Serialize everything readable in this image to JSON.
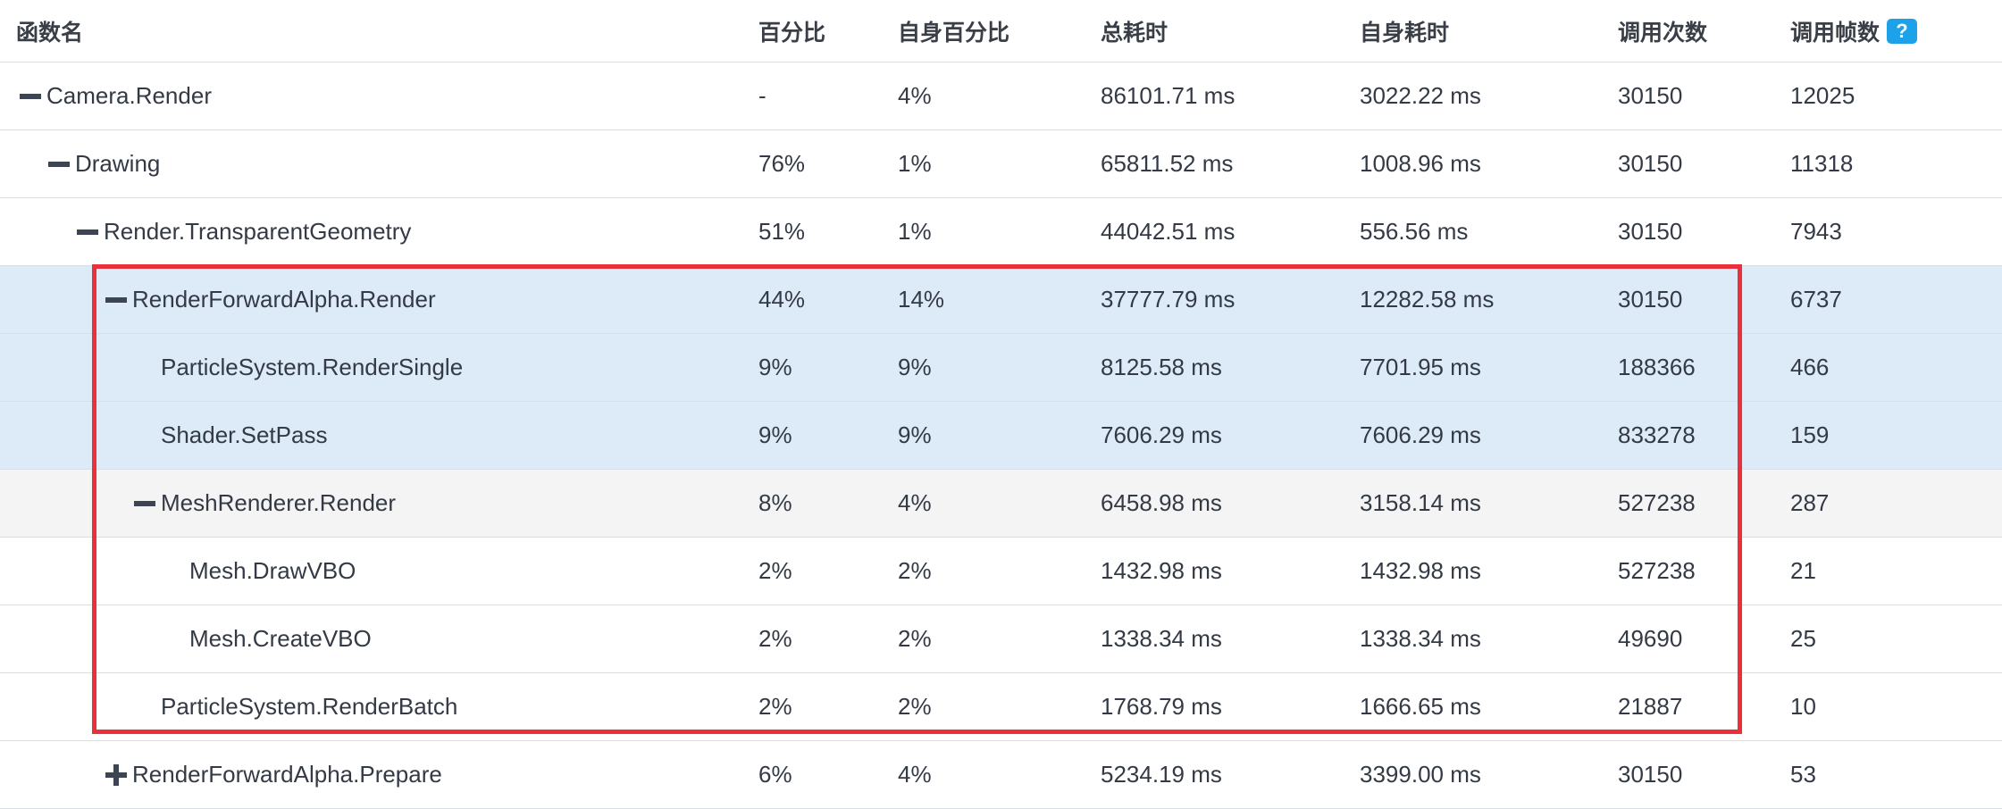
{
  "header": {
    "function_name": "函数名",
    "percent": "百分比",
    "self_percent": "自身百分比",
    "total_time": "总耗时",
    "self_time": "自身耗时",
    "call_count": "调用次数",
    "call_frames": "调用帧数",
    "help_icon": "?"
  },
  "rows": [
    {
      "name": "Camera.Render",
      "percent": "-",
      "self_percent": "4%",
      "total_time": "86101.71 ms",
      "self_time": "3022.22 ms",
      "calls": "30150",
      "frames": "12025",
      "toggle": "minus",
      "depth": 0
    },
    {
      "name": "Drawing",
      "percent": "76%",
      "self_percent": "1%",
      "total_time": "65811.52 ms",
      "self_time": "1008.96 ms",
      "calls": "30150",
      "frames": "11318",
      "toggle": "minus",
      "depth": 1
    },
    {
      "name": "Render.TransparentGeometry",
      "percent": "51%",
      "self_percent": "1%",
      "total_time": "44042.51 ms",
      "self_time": "556.56 ms",
      "calls": "30150",
      "frames": "7943",
      "toggle": "minus",
      "depth": 2
    },
    {
      "name": "RenderForwardAlpha.Render",
      "percent": "44%",
      "self_percent": "14%",
      "total_time": "37777.79 ms",
      "self_time": "12282.58 ms",
      "calls": "30150",
      "frames": "6737",
      "toggle": "minus",
      "depth": 3
    },
    {
      "name": "ParticleSystem.RenderSingle",
      "percent": "9%",
      "self_percent": "9%",
      "total_time": "8125.58 ms",
      "self_time": "7701.95 ms",
      "calls": "188366",
      "frames": "466",
      "toggle": "none",
      "depth": 4
    },
    {
      "name": "Shader.SetPass",
      "percent": "9%",
      "self_percent": "9%",
      "total_time": "7606.29 ms",
      "self_time": "7606.29 ms",
      "calls": "833278",
      "frames": "159",
      "toggle": "none",
      "depth": 4
    },
    {
      "name": "MeshRenderer.Render",
      "percent": "8%",
      "self_percent": "4%",
      "total_time": "6458.98 ms",
      "self_time": "3158.14 ms",
      "calls": "527238",
      "frames": "287",
      "toggle": "minus",
      "depth": 4
    },
    {
      "name": "Mesh.DrawVBO",
      "percent": "2%",
      "self_percent": "2%",
      "total_time": "1432.98 ms",
      "self_time": "1432.98 ms",
      "calls": "527238",
      "frames": "21",
      "toggle": "none",
      "depth": 5
    },
    {
      "name": "Mesh.CreateVBO",
      "percent": "2%",
      "self_percent": "2%",
      "total_time": "1338.34 ms",
      "self_time": "1338.34 ms",
      "calls": "49690",
      "frames": "25",
      "toggle": "none",
      "depth": 5
    },
    {
      "name": "ParticleSystem.RenderBatch",
      "percent": "2%",
      "self_percent": "2%",
      "total_time": "1768.79 ms",
      "self_time": "1666.65 ms",
      "calls": "21887",
      "frames": "10",
      "toggle": "none",
      "depth": 4
    },
    {
      "name": "RenderForwardAlpha.Prepare",
      "percent": "6%",
      "self_percent": "4%",
      "total_time": "5234.19 ms",
      "self_time": "3399.00 ms",
      "calls": "30150",
      "frames": "53",
      "toggle": "plus",
      "depth": 3
    }
  ],
  "colors": {
    "selected_row": "#dcebf7",
    "hover_row": "#f4f4f4",
    "highlight_border": "#e8313b",
    "help_badge": "#1da1e8"
  }
}
